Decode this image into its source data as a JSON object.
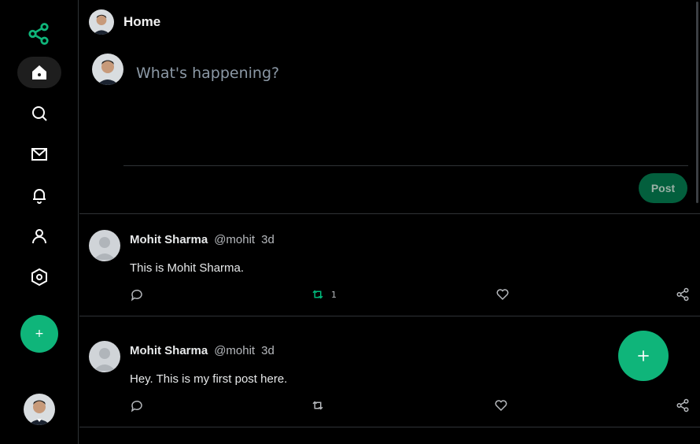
{
  "header": {
    "title": "Home"
  },
  "composer": {
    "placeholder": "What's happening?",
    "post_label": "Post"
  },
  "sidebar": {
    "items": [
      {
        "name": "home",
        "icon": "home-icon",
        "active": true
      },
      {
        "name": "explore",
        "icon": "search-icon"
      },
      {
        "name": "messages",
        "icon": "mail-icon"
      },
      {
        "name": "notifications",
        "icon": "bell-icon"
      },
      {
        "name": "profile",
        "icon": "user-icon"
      },
      {
        "name": "settings",
        "icon": "hexagon-settings-icon"
      }
    ],
    "compose_label": "+"
  },
  "tweets": [
    {
      "name": "Mohit Sharma",
      "handle": "@mohit",
      "time": "3d",
      "text": "This is Mohit Sharma.",
      "retweets": "1"
    },
    {
      "name": "Mohit Sharma",
      "handle": "@mohit",
      "time": "3d",
      "text": "Hey. This is my first post here.",
      "retweets": ""
    }
  ],
  "colors": {
    "accent": "#0fb57a",
    "retweet_active": "#00ba7c",
    "post_button": "#035f3d"
  }
}
